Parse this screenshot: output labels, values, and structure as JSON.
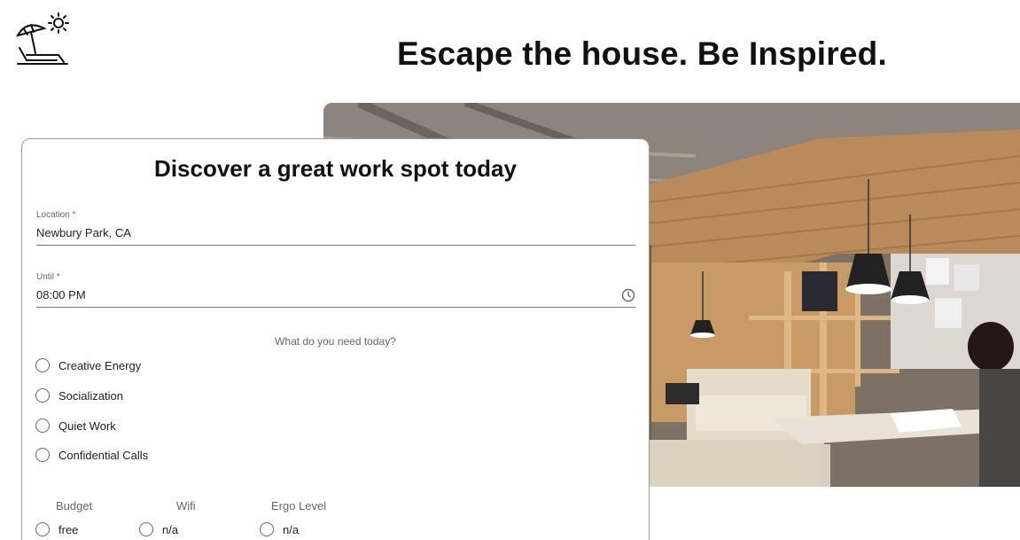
{
  "header": {
    "logo_icon": "beach-umbrella-sun-icon",
    "headline": "Escape the house. Be Inspired."
  },
  "hero": {
    "image_icon": "cafe-workspace-photo"
  },
  "form": {
    "title": "Discover a great work spot today",
    "location": {
      "label": "Location *",
      "value": "Newbury Park, CA"
    },
    "until": {
      "label": "Until *",
      "value": "08:00 PM",
      "icon": "clock-icon"
    },
    "question": "What do you need today?",
    "needs": [
      {
        "label": "Creative Energy",
        "selected": false
      },
      {
        "label": "Socialization",
        "selected": false
      },
      {
        "label": "Quiet Work",
        "selected": false
      },
      {
        "label": "Confidential Calls",
        "selected": false
      }
    ],
    "filters": [
      {
        "label": "Budget",
        "option": "free"
      },
      {
        "label": "Wifi",
        "option": "n/a"
      },
      {
        "label": "Ergo Level",
        "option": "n/a"
      }
    ]
  },
  "colors": {
    "text": "#111111",
    "muted": "#666666",
    "card_border": "#9a9a9a"
  }
}
